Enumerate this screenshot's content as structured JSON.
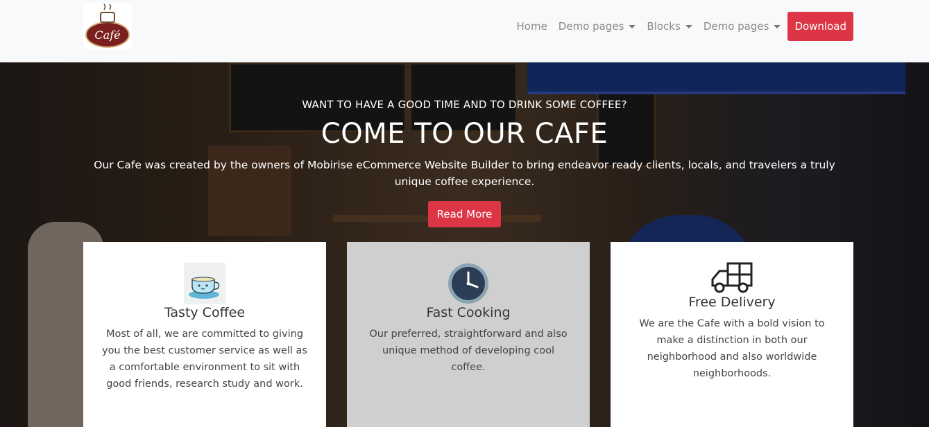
{
  "nav": {
    "logo_text": "Café",
    "links": [
      {
        "label": "Home"
      },
      {
        "label": "Demo pages"
      },
      {
        "label": "Blocks"
      },
      {
        "label": "Demo pages"
      }
    ],
    "download_label": "Download"
  },
  "hero": {
    "subtitle": "WANT TO HAVE A GOOD TIME AND TO DRINK SOME COFFEE?",
    "title": "COME TO OUR CAFE",
    "description": "Our Cafe was created by the owners of Mobirise eCommerce Website Builder to bring endeavor ready clients, locals, and travelers a truly unique coffee experience.",
    "button_label": "Read More"
  },
  "features": [
    {
      "icon": "coffee-cup-icon",
      "title": "Tasty Coffee",
      "text": "Most of all, we are committed to giving you the best customer service as well as a comfortable environment to sit with good friends, research study and work."
    },
    {
      "icon": "clock-icon",
      "title": "Fast Cooking",
      "text": "Our preferred, straightforward and also unique method of developing cool coffee."
    },
    {
      "icon": "delivery-truck-icon",
      "title": "Free Delivery",
      "text": "We are the Cafe with a bold vision to make a distinction in both our neighborhood and also worldwide neighborhoods."
    }
  ],
  "colors": {
    "accent": "#dc3545",
    "navbar_bg": "#f8f9fa",
    "card_grey": "#cfcfcf"
  }
}
